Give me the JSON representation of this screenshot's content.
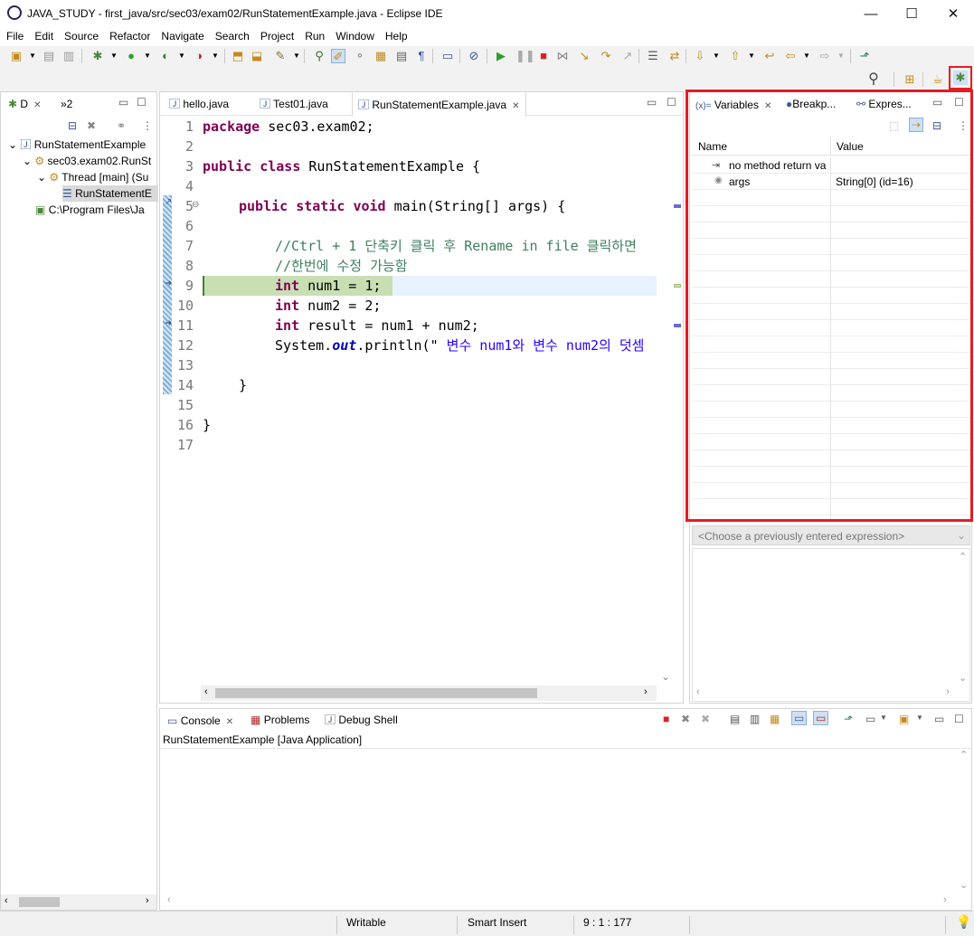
{
  "window": {
    "title": "JAVA_STUDY - first_java/src/sec03/exam02/RunStatementExample.java - Eclipse IDE",
    "minimize": "—",
    "maximize": "☐",
    "close": "✕"
  },
  "menu": [
    "File",
    "Edit",
    "Source",
    "Refactor",
    "Navigate",
    "Search",
    "Project",
    "Run",
    "Window",
    "Help"
  ],
  "debug_view": {
    "tab_label": "D",
    "overflow_label": "»2",
    "tree": [
      {
        "label": "RunStatementExample"
      },
      {
        "label": "sec03.exam02.RunSt"
      },
      {
        "label": "Thread [main] (Su"
      },
      {
        "label": "RunStatementE"
      },
      {
        "label": "C:\\Program Files\\Ja"
      }
    ]
  },
  "editor": {
    "tabs": [
      {
        "label": "hello.java"
      },
      {
        "label": "Test01.java"
      },
      {
        "label": "RunStatementExample.java"
      }
    ],
    "line_numbers": [
      "1",
      "2",
      "3",
      "4",
      "5",
      "6",
      "7",
      "8",
      "9",
      "10",
      "11",
      "12",
      "13",
      "14",
      "15",
      "16",
      "17"
    ],
    "code": {
      "l1_kw": "package",
      "l1_rest": " sec03.exam02;",
      "l3_kw1": "public",
      "l3_kw2": "class",
      "l3_rest": " RunStatementExample {",
      "l5_kw1": "public",
      "l5_kw2": "static",
      "l5_kw3": "void",
      "l5_rest": " main(String[] args) {",
      "l7": "//Ctrl + 1 단축키 클릭 후 Rename in file 클릭하면",
      "l8": "//한번에 수정 가능함",
      "l9_kw": "int",
      "l9_rest": " num1 = 1;",
      "l10_kw": "int",
      "l10_rest": " num2 = 2;",
      "l11_kw": "int",
      "l11_rest": " result = num1 + num2;",
      "l12_a": "System.",
      "l12_out": "out",
      "l12_b": ".println(\"",
      "l12_str": " 변수 num1와 변수 num2의 덧셈",
      "l14": "}",
      "l16": "}"
    }
  },
  "variables_view": {
    "tabs": [
      {
        "label": "Variables",
        "prefix": "(x)="
      },
      {
        "label": "Breakp..."
      },
      {
        "label": "Expres..."
      }
    ],
    "columns": [
      "Name",
      "Value"
    ],
    "rows": [
      {
        "name": "no method return va",
        "value": ""
      },
      {
        "name": "args",
        "value": "String[0]  (id=16)"
      }
    ],
    "highlight_color": "#e51c23"
  },
  "expression_box": {
    "placeholder": "<Choose a previously entered expression>"
  },
  "console_view": {
    "tabs": [
      {
        "label": "Console"
      },
      {
        "label": "Problems"
      },
      {
        "label": "Debug Shell"
      }
    ],
    "header": "RunStatementExample [Java Application]"
  },
  "status_bar": {
    "writable": "Writable",
    "insert_mode": "Smart Insert",
    "position": "9 : 1 : 177"
  },
  "colors": {
    "current_line": "#c8dfb4",
    "keyword": "#7f0055",
    "comment": "#3f7f5f",
    "string": "#2a00ff"
  }
}
